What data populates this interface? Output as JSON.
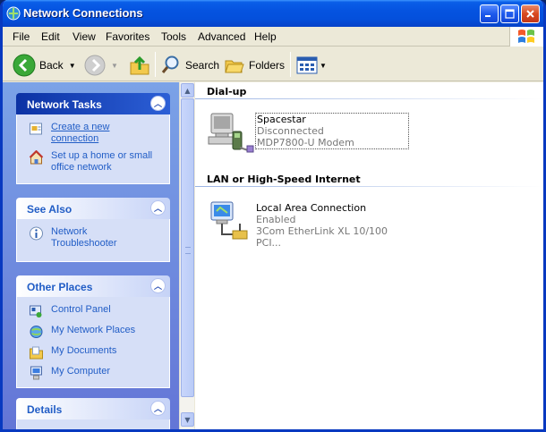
{
  "window": {
    "title": "Network Connections"
  },
  "menu": [
    "File",
    "Edit",
    "View",
    "Favorites",
    "Tools",
    "Advanced",
    "Help"
  ],
  "toolbar": {
    "back_label": "Back",
    "search_label": "Search",
    "folders_label": "Folders"
  },
  "taskpane": {
    "network_tasks": {
      "title": "Network Tasks",
      "items": [
        {
          "line1": "Create a new",
          "line2": "connection",
          "icon": "new-connection-icon"
        },
        {
          "line1": "Set up a home or small",
          "line2": "office network",
          "icon": "home-network-icon"
        }
      ]
    },
    "see_also": {
      "title": "See Also",
      "items": [
        {
          "line1": "Network",
          "line2": "Troubleshooter",
          "icon": "info-icon"
        }
      ]
    },
    "other_places": {
      "title": "Other Places",
      "items": [
        {
          "label": "Control Panel",
          "icon": "control-panel-icon"
        },
        {
          "label": "My Network Places",
          "icon": "network-places-icon"
        },
        {
          "label": "My Documents",
          "icon": "documents-folder-icon"
        },
        {
          "label": "My Computer",
          "icon": "computer-icon"
        }
      ]
    },
    "details": {
      "title": "Details"
    }
  },
  "content": {
    "groups": [
      {
        "title": "Dial-up",
        "connections": [
          {
            "name": "Spacestar",
            "status": "Disconnected",
            "device": "MDP7800-U Modem"
          }
        ]
      },
      {
        "title": "LAN or High-Speed Internet",
        "connections": [
          {
            "name": "Local Area Connection",
            "status": "Enabled",
            "device": "3Com EtherLink XL 10/100 PCI..."
          }
        ]
      }
    ]
  },
  "colors": {
    "titlebar": "#0553e0",
    "taskpane": "#7ba2e7",
    "link": "#215dc6"
  }
}
